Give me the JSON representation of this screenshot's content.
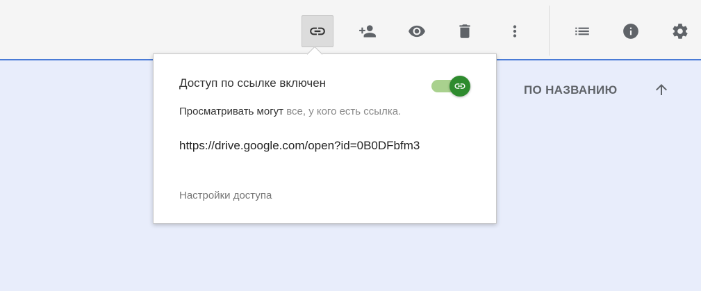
{
  "toolbar": {
    "buttons": [
      {
        "name": "get-link-icon",
        "active": true
      },
      {
        "name": "add-person-icon",
        "active": false
      },
      {
        "name": "preview-eye-icon",
        "active": false
      },
      {
        "name": "trash-icon",
        "active": false
      },
      {
        "name": "more-vert-icon",
        "active": false
      },
      {
        "name": "list-view-icon",
        "active": false
      },
      {
        "name": "info-icon",
        "active": false
      },
      {
        "name": "settings-gear-icon",
        "active": false
      }
    ]
  },
  "sort": {
    "label": "ПО НАЗВАНИЮ",
    "direction_icon": "arrow-up-icon"
  },
  "share_popup": {
    "title": "Доступ по ссылке включен",
    "toggle_on": true,
    "viewers_prefix": "Просматривать могут",
    "viewers_scope": " все, у кого есть ссылка.",
    "link_value": "https://drive.google.com/open?id=0B0DFbfm3",
    "access_settings": "Настройки доступа"
  },
  "colors": {
    "accent_blue": "#4a7bd6",
    "toggle_green": "#2e8b2e",
    "toggle_track": "#a9d18e",
    "content_bg": "#e8edfb",
    "icon_grey": "#5f6368"
  }
}
